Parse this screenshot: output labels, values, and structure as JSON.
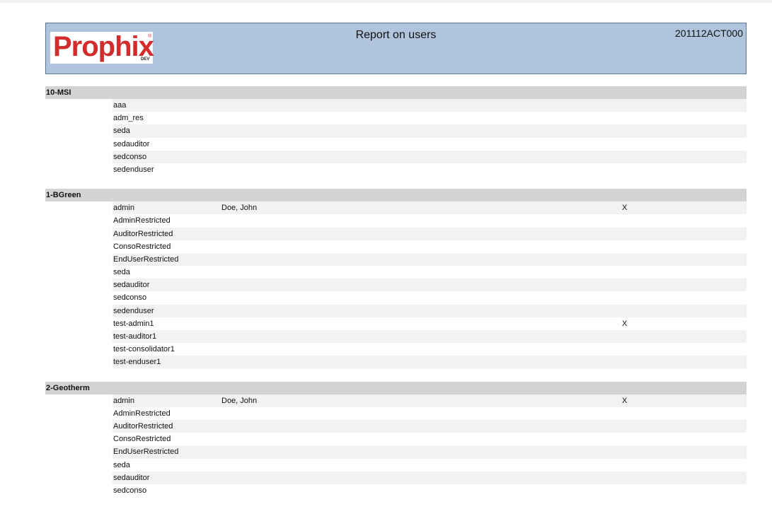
{
  "header": {
    "logo_text": "Prophix",
    "logo_reg": "®",
    "logo_sub": "DEV",
    "title": "Report on users",
    "code": "201112ACT000"
  },
  "groups": [
    {
      "name": "10-MSI",
      "rows": [
        {
          "user": "aaa",
          "name": "",
          "flag": ""
        },
        {
          "user": "adm_res",
          "name": "",
          "flag": ""
        },
        {
          "user": "seda",
          "name": "",
          "flag": ""
        },
        {
          "user": "sedauditor",
          "name": "",
          "flag": ""
        },
        {
          "user": "sedconso",
          "name": "",
          "flag": ""
        },
        {
          "user": "sedenduser",
          "name": "",
          "flag": ""
        }
      ]
    },
    {
      "name": "1-BGreen",
      "rows": [
        {
          "user": "admin",
          "name": "Doe, John",
          "flag": "X"
        },
        {
          "user": "AdminRestricted",
          "name": "",
          "flag": ""
        },
        {
          "user": "AuditorRestricted",
          "name": "",
          "flag": ""
        },
        {
          "user": "ConsoRestricted",
          "name": "",
          "flag": ""
        },
        {
          "user": "EndUserRestricted",
          "name": "",
          "flag": ""
        },
        {
          "user": "seda",
          "name": "",
          "flag": ""
        },
        {
          "user": "sedauditor",
          "name": "",
          "flag": ""
        },
        {
          "user": "sedconso",
          "name": "",
          "flag": ""
        },
        {
          "user": "sedenduser",
          "name": "",
          "flag": ""
        },
        {
          "user": "test-admin1",
          "name": "",
          "flag": "X"
        },
        {
          "user": "test-auditor1",
          "name": "",
          "flag": ""
        },
        {
          "user": "test-consolidator1",
          "name": "",
          "flag": ""
        },
        {
          "user": "test-enduser1",
          "name": "",
          "flag": ""
        }
      ]
    },
    {
      "name": "2-Geotherm",
      "rows": [
        {
          "user": "admin",
          "name": "Doe, John",
          "flag": "X"
        },
        {
          "user": "AdminRestricted",
          "name": "",
          "flag": ""
        },
        {
          "user": "AuditorRestricted",
          "name": "",
          "flag": ""
        },
        {
          "user": "ConsoRestricted",
          "name": "",
          "flag": ""
        },
        {
          "user": "EndUserRestricted",
          "name": "",
          "flag": ""
        },
        {
          "user": "seda",
          "name": "",
          "flag": ""
        },
        {
          "user": "sedauditor",
          "name": "",
          "flag": ""
        },
        {
          "user": "sedconso",
          "name": "",
          "flag": ""
        }
      ]
    }
  ]
}
